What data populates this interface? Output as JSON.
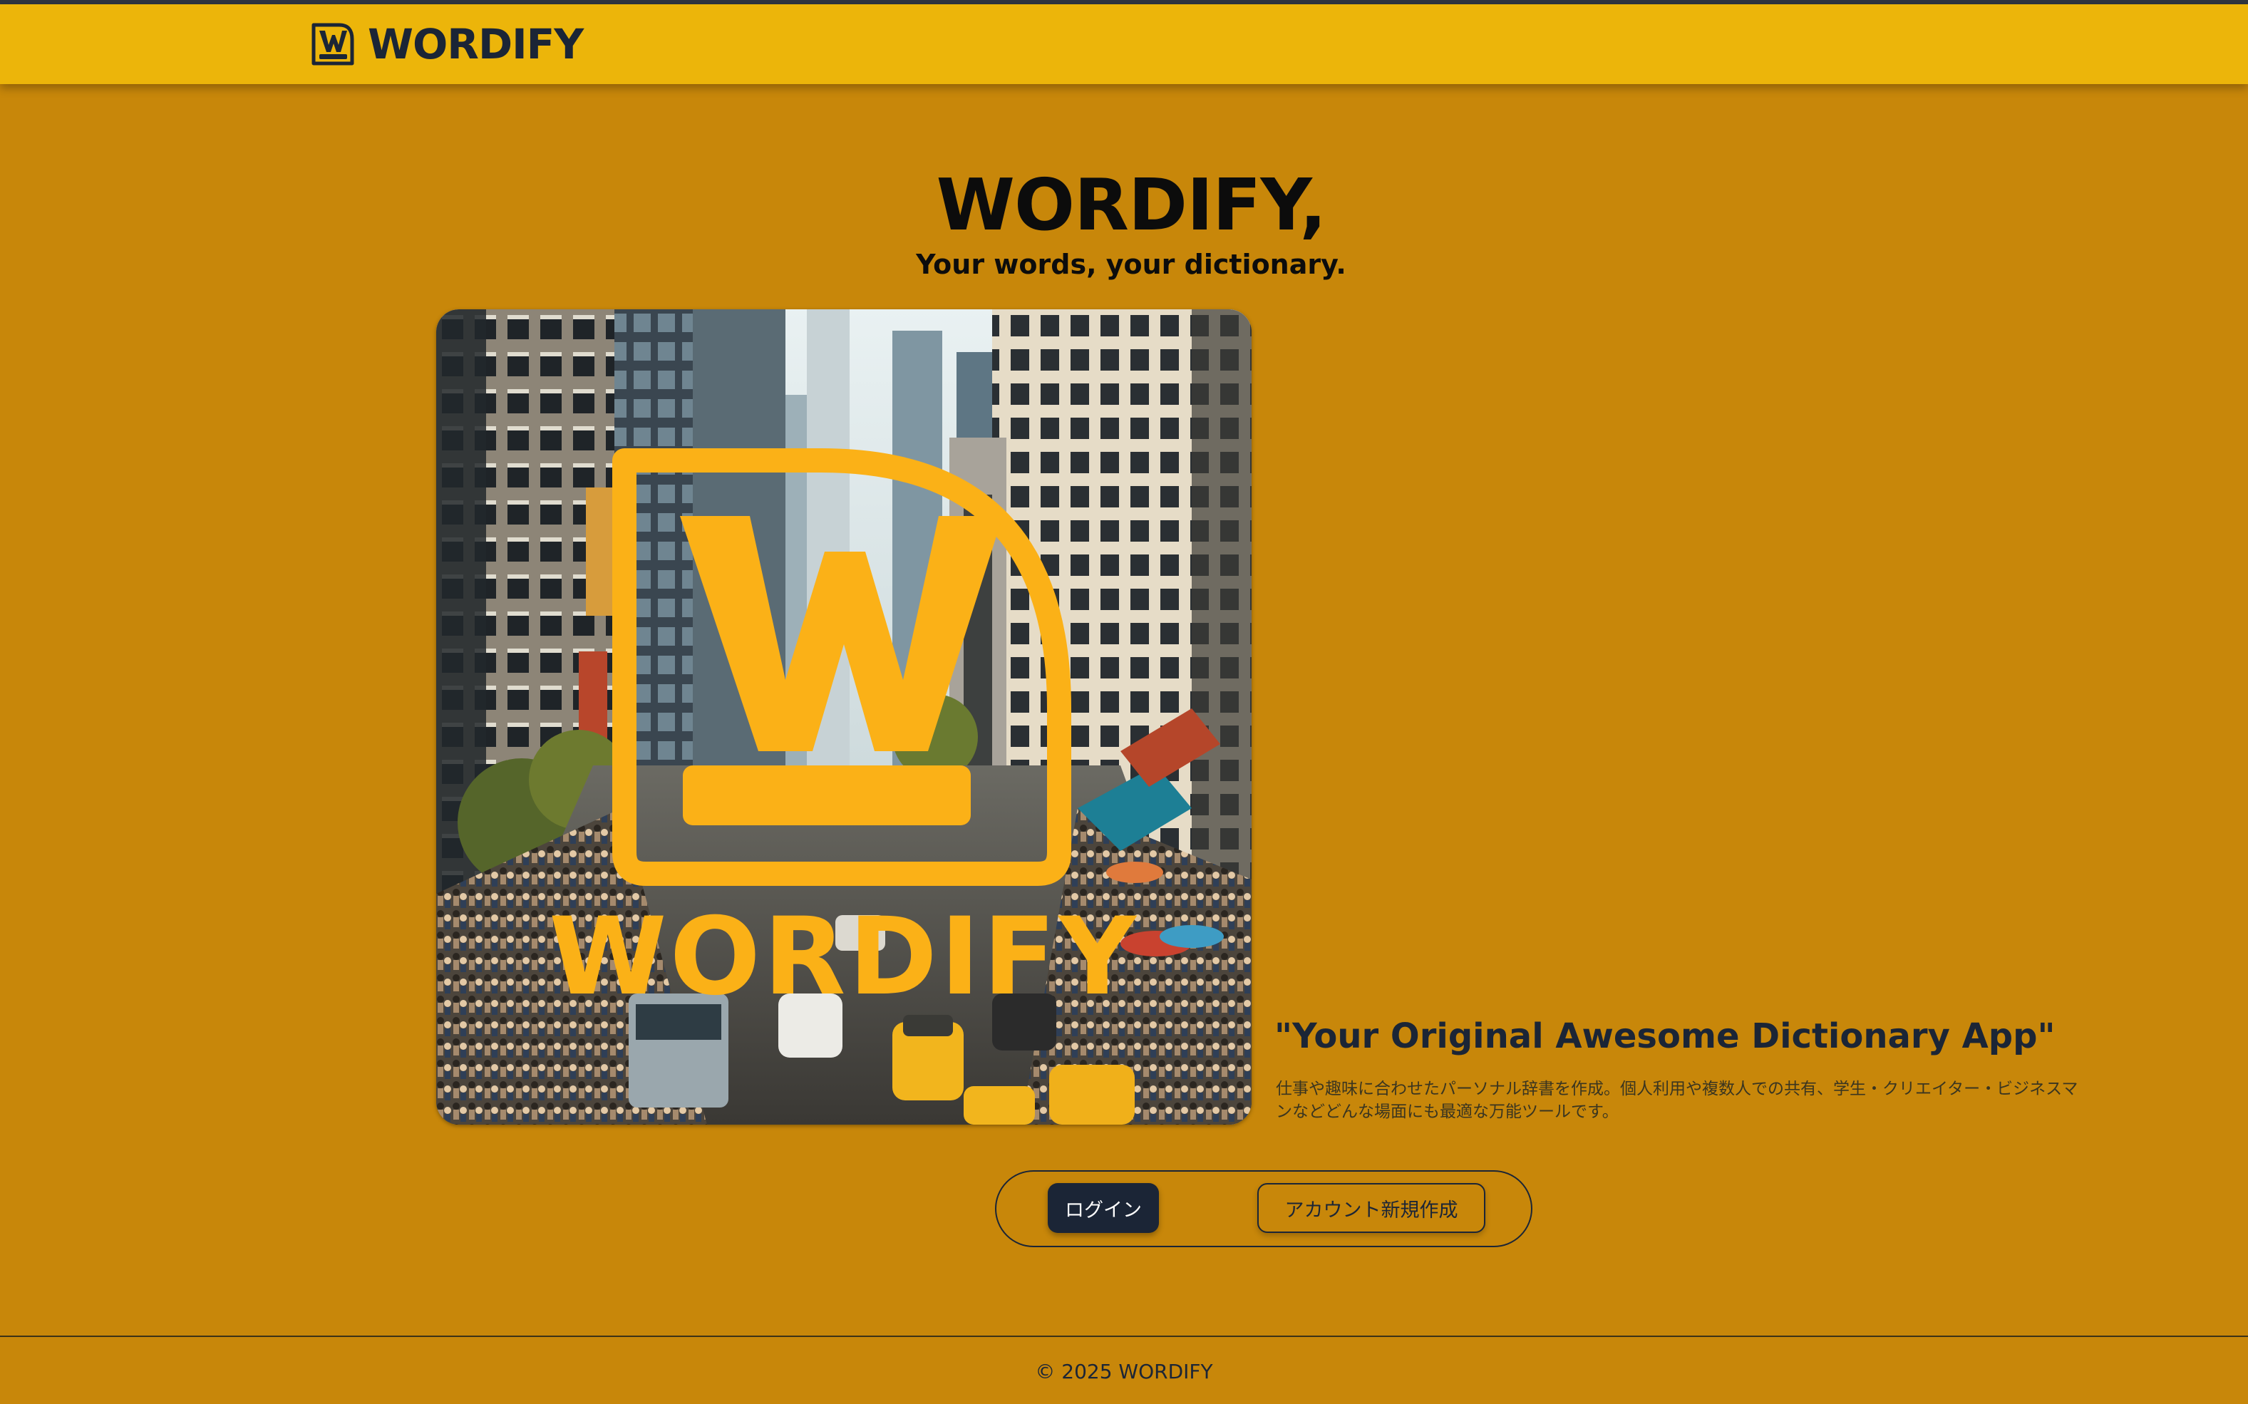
{
  "header": {
    "brand_name": "WORDIFY",
    "logo_icon": "wordify-w-logo-icon"
  },
  "hero": {
    "title": "WORDIFY,",
    "subtitle": "Your words, your dictionary.",
    "image_icon": "wordify-city-hero-image",
    "image_wordmark": "WORDIFY"
  },
  "intro": {
    "tagline": "\"Your Original Awesome Dictionary App\"",
    "description": "仕事や趣味に合わせたパーソナル辞書を作成。個人利用や複数人での共有、学生・クリエイター・ビジネスマンなどどんな場面にも最適な万能ツールです。"
  },
  "actions": {
    "login_label": "ログイン",
    "signup_label": "アカウント新規作成"
  },
  "footer": {
    "copyright": "© 2025 WORDIFY"
  },
  "colors": {
    "page_background": "#c8870a",
    "header_background": "#ecb50a",
    "brand_dark": "#1b2536",
    "logo_yellow": "#fbb117"
  }
}
